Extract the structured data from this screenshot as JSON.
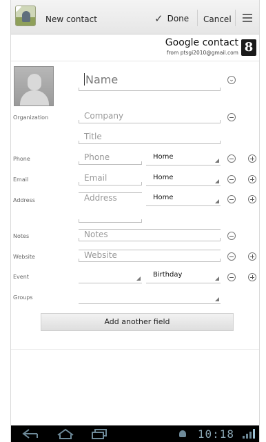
{
  "action_bar": {
    "title": "New contact",
    "done_label": "Done",
    "cancel_label": "Cancel"
  },
  "account": {
    "type": "Google contact",
    "email": "from ptsgi2010@gmail.com",
    "logo_letter": "8"
  },
  "name_field": {
    "placeholder": "Name"
  },
  "organization": {
    "label": "Organization",
    "company_placeholder": "Company",
    "title_placeholder": "Title"
  },
  "phone": {
    "label": "Phone",
    "placeholder": "Phone",
    "type": "Home"
  },
  "email": {
    "label": "Email",
    "placeholder": "Email",
    "type": "Home"
  },
  "address": {
    "label": "Address",
    "placeholder": "Address",
    "type": "Home"
  },
  "notes": {
    "label": "Notes",
    "placeholder": "Notes"
  },
  "website": {
    "label": "Website",
    "placeholder": "Website"
  },
  "event": {
    "label": "Event",
    "date_value": "",
    "type": "Birthday"
  },
  "groups": {
    "label": "Groups",
    "value": ""
  },
  "add_field_label": "Add another field",
  "system_bar": {
    "time": "10:18"
  },
  "icons": [
    "contact-app-icon",
    "check-icon",
    "menu-icon",
    "google-logo-icon",
    "contact-photo",
    "expand-icon",
    "remove-icon",
    "add-icon",
    "back-icon",
    "home-icon",
    "recent-apps-icon",
    "android-icon",
    "signal-icon"
  ]
}
